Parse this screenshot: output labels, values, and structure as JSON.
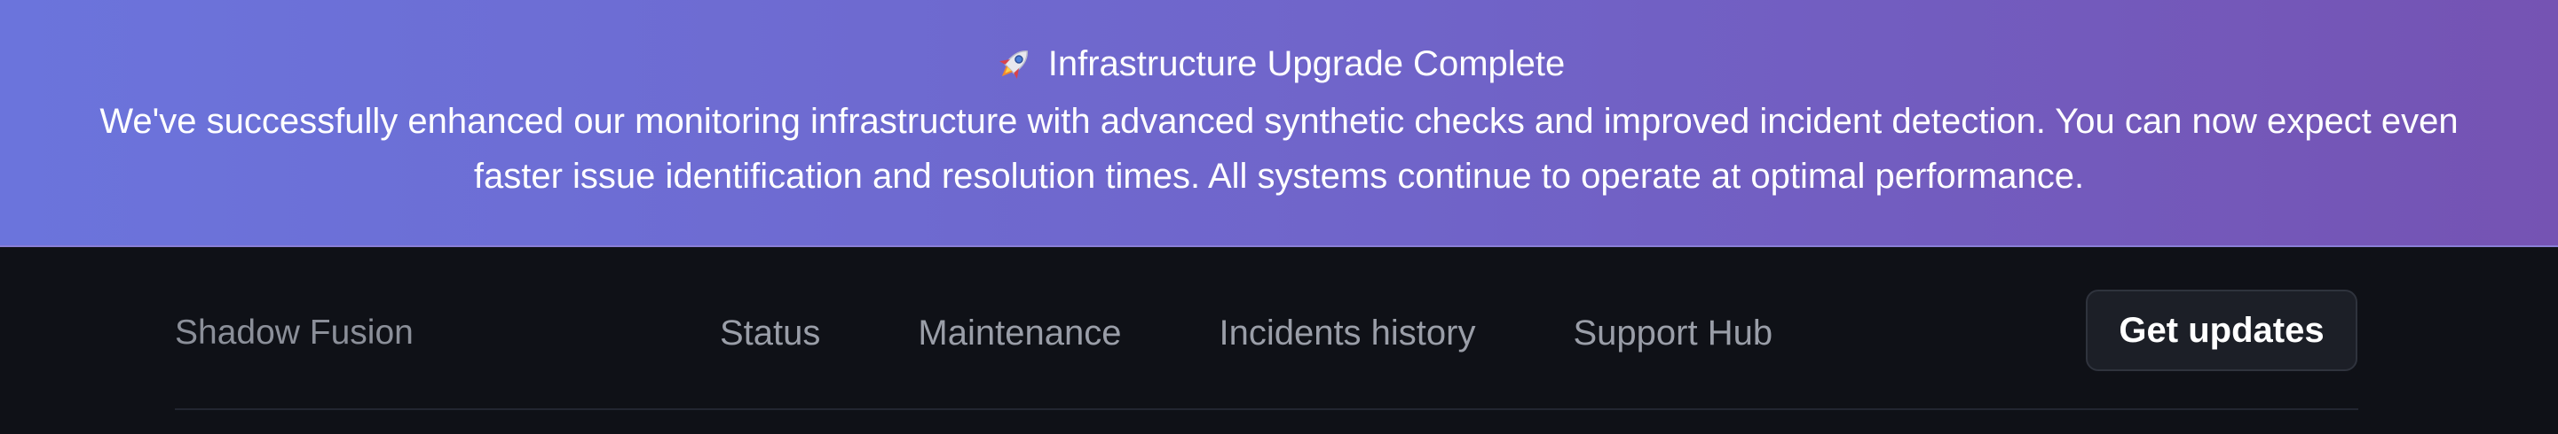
{
  "banner": {
    "title": "Infrastructure Upgrade Complete",
    "icon": "rocket-icon",
    "message": "We've successfully enhanced our monitoring infrastructure with advanced synthetic checks and improved incident detection. You can now expect even faster issue identification and resolution times. All systems continue to operate at optimal performance.",
    "gradient_start": "#6b74dc",
    "gradient_end": "#7553b3"
  },
  "nav": {
    "brand": "Shadow Fusion",
    "links": [
      {
        "label": "Status"
      },
      {
        "label": "Maintenance"
      },
      {
        "label": "Incidents history"
      },
      {
        "label": "Support Hub"
      }
    ],
    "cta_label": "Get updates",
    "background": "#0f1117"
  }
}
